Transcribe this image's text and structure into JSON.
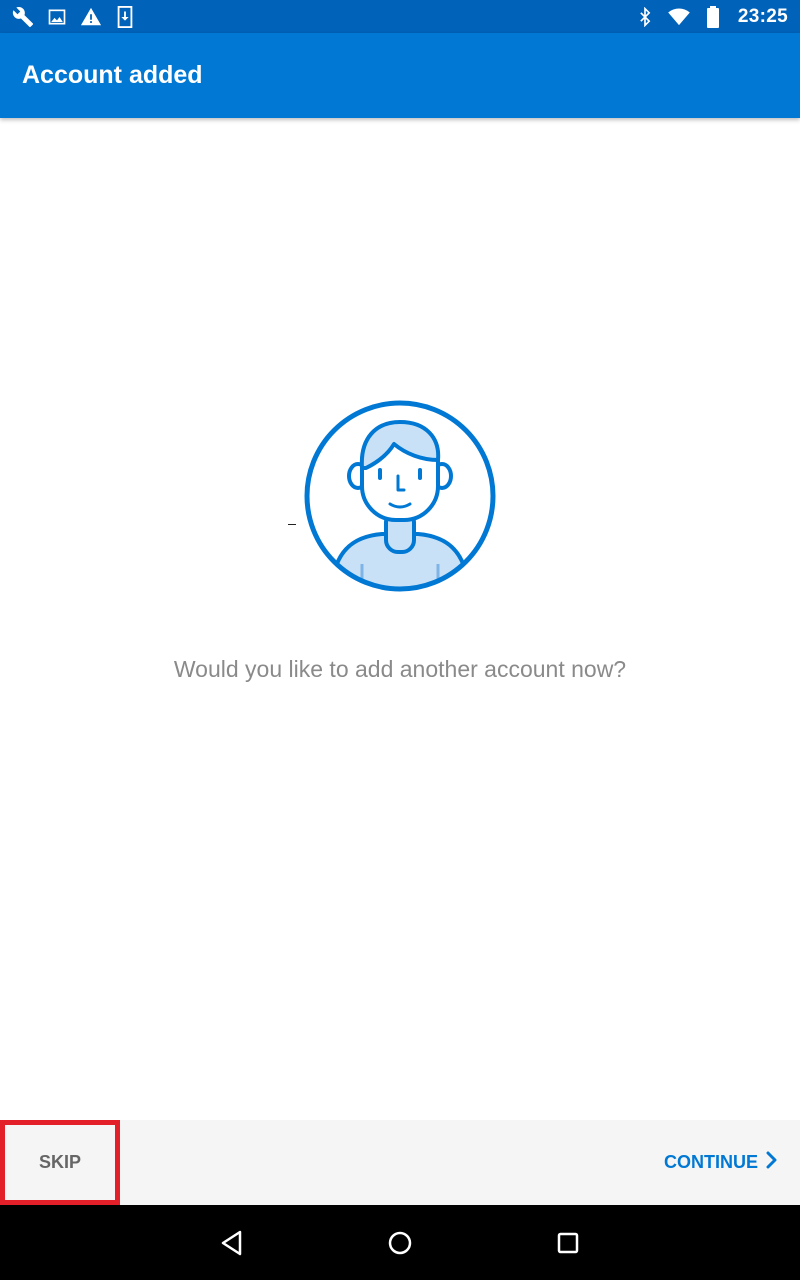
{
  "status_bar": {
    "time": "23:25",
    "left_icons": [
      "wrench-icon",
      "image-icon",
      "warning-icon",
      "download-icon"
    ],
    "right_icons": [
      "bluetooth-icon",
      "wifi-icon",
      "battery-icon"
    ]
  },
  "app_bar": {
    "title": "Account added"
  },
  "main": {
    "prompt": "Would you like to add another account now?",
    "illustration": "person-avatar-icon"
  },
  "footer": {
    "skip_label": "SKIP",
    "continue_label": "CONTINUE"
  },
  "nav": {
    "icons": [
      "back-icon",
      "home-icon",
      "recents-icon"
    ]
  },
  "colors": {
    "status_bar": "#0062b8",
    "app_bar": "#0078d4",
    "accent": "#0078d4",
    "highlight_border": "#e3202a",
    "prompt_text": "#8a8a8a"
  }
}
